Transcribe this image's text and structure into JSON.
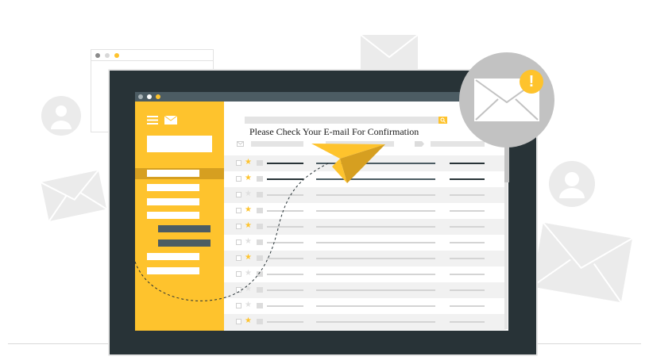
{
  "message": "Please Check Your E-mail For Confirmation",
  "colors": {
    "accent": "#fec32d",
    "accent_dark": "#d69f20",
    "frame": "#283337",
    "slate": "#4c5c63",
    "line_gray": "#d4d4d4",
    "line_dark": "#283337",
    "background_gray": "#ebebeb"
  },
  "icons": {
    "menu": "hamburger-icon",
    "mail": "envelope-icon",
    "search": "magnifier-icon",
    "alert": "exclamation-icon",
    "plane": "paper-plane-icon",
    "avatar": "user-avatar-icon"
  },
  "alert_symbol": "!",
  "inbox": {
    "rows": [
      {
        "starred": true,
        "unread": true,
        "shaded": true
      },
      {
        "starred": true,
        "unread": true,
        "shaded": false
      },
      {
        "starred": false,
        "unread": false,
        "shaded": true
      },
      {
        "starred": true,
        "unread": false,
        "shaded": false
      },
      {
        "starred": true,
        "unread": false,
        "shaded": true
      },
      {
        "starred": false,
        "unread": false,
        "shaded": false
      },
      {
        "starred": true,
        "unread": false,
        "shaded": true
      },
      {
        "starred": false,
        "unread": false,
        "shaded": false
      },
      {
        "starred": false,
        "unread": false,
        "shaded": true
      },
      {
        "starred": false,
        "unread": false,
        "shaded": false
      },
      {
        "starred": true,
        "unread": false,
        "shaded": true
      }
    ]
  }
}
